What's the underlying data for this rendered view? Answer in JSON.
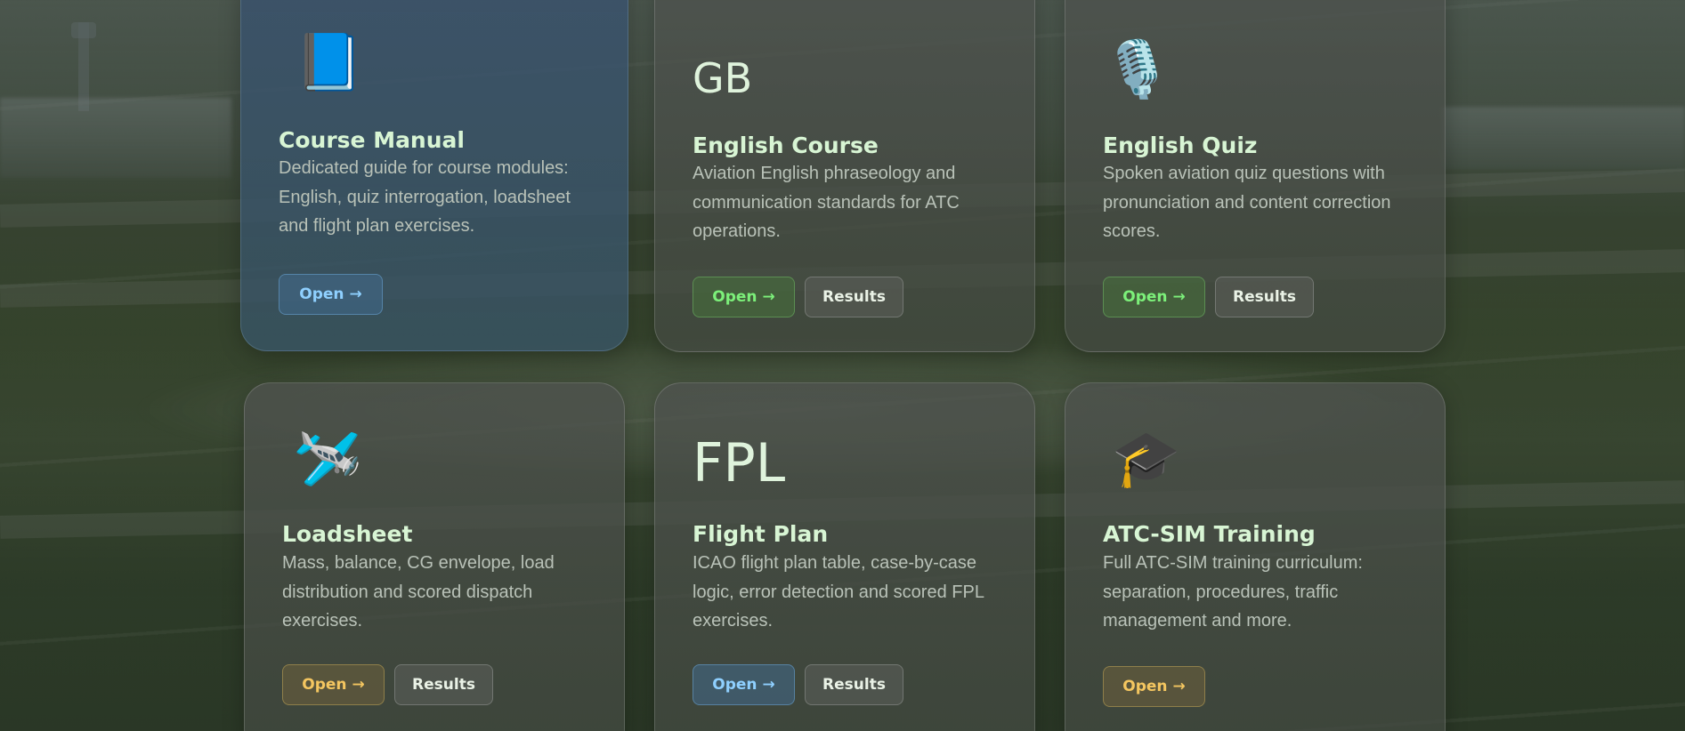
{
  "cards": [
    {
      "icon_name": "book-icon",
      "icon": "📘",
      "title": "Course Manual",
      "description": "Dedicated guide for course modules: English, quiz interrogation, loadsheet and flight plan exercises.",
      "open_label": "Open →"
    },
    {
      "icon_name": "gb-flag-icon",
      "icon": "GB",
      "title": "English Course",
      "description": "Aviation English phraseology and communication standards for ATC operations.",
      "open_label": "Open →",
      "results_label": "Results"
    },
    {
      "icon_name": "microphone-icon",
      "icon": "🎙️",
      "title": "English Quiz",
      "description": "Spoken aviation quiz questions with pronunciation and content correction scores.",
      "open_label": "Open →",
      "results_label": "Results"
    },
    {
      "icon_name": "airplane-icon",
      "icon": "🛩️",
      "title": "Loadsheet",
      "description": "Mass, balance, CG envelope, load distribution and scored dispatch exercises.",
      "open_label": "Open →",
      "results_label": "Results"
    },
    {
      "icon_name": "fpl-icon",
      "icon": "FPL",
      "title": "Flight Plan",
      "description": "ICAO flight plan table, case-by-case logic, error detection and scored FPL exercises.",
      "open_label": "Open →",
      "results_label": "Results"
    },
    {
      "icon_name": "graduation-cap-icon",
      "icon": "🎓",
      "title": "ATC-SIM Training",
      "description": "Full ATC-SIM training curriculum: separation, procedures, traffic management and more.",
      "open_label": "Open →"
    }
  ],
  "colors": {
    "title": "#d8f5d4",
    "description": "#b9c2b8",
    "open_blue": "#8fd0ff",
    "open_green": "#7cf07a",
    "open_amber": "#f4c660"
  }
}
